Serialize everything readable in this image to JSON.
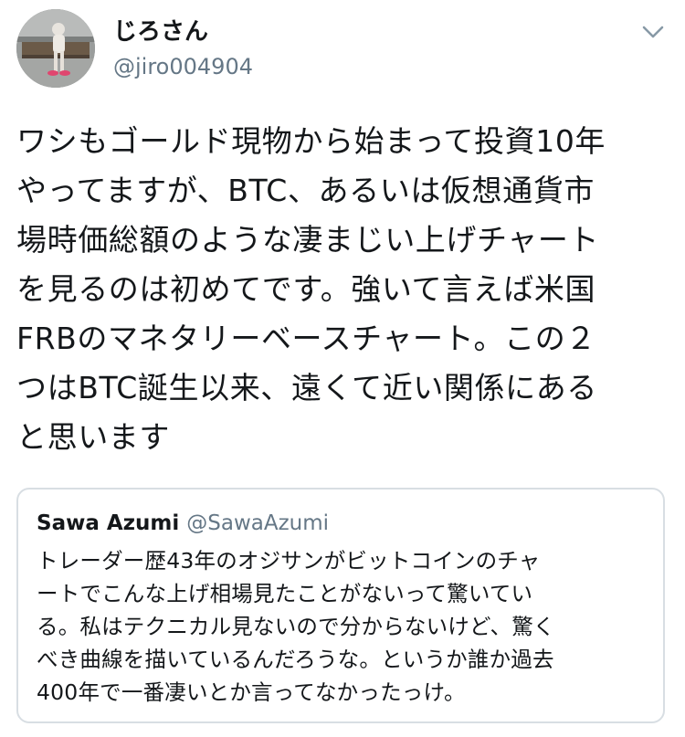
{
  "tweet": {
    "author": {
      "display_name": "じろさん",
      "handle": "@jiro004904"
    },
    "menu_icon": "chevron-down-icon",
    "text_lines": [
      "ワシもゴールド現物から始まって投資10年",
      "やってますが、BTC、あるいは仮想通貨市",
      "場時価総額のような凄まじい上げチャート",
      "を見るのは初めてです。強いて言えば米国",
      "FRBのマネタリーベースチャート。この２",
      "つはBTC誕生以来、遠くて近い関係にある",
      "と思います"
    ]
  },
  "quoted_tweet": {
    "display_name": "Sawa Azumi",
    "handle": "@SawaAzumi",
    "text_lines": [
      "トレーダー歴43年のオジサンがビットコインのチャ",
      "ートでこんな上げ相場見たことがないって驚いてい",
      "る。私はテクニカル見ないので分からないけど、驚く",
      "べき曲線を描いているんだろうな。というか誰か過去",
      "400年で一番凄いとか言ってなかったっけ。"
    ]
  },
  "colors": {
    "text_primary": "#14171a",
    "text_secondary": "#657786",
    "card_border": "#d8dee3",
    "icon": "#8899a6"
  }
}
